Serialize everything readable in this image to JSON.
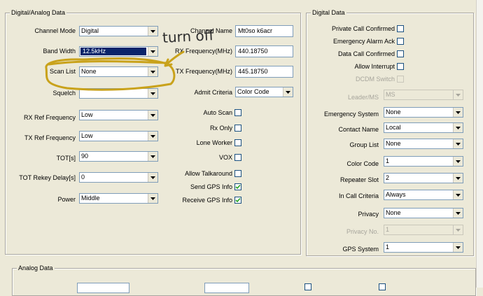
{
  "digital_analog": {
    "title": "Digital/Analog Data",
    "left_fields": {
      "channel_mode": {
        "label": "Channel Mode",
        "value": "Digital"
      },
      "band_width": {
        "label": "Band Width",
        "value": "12.5kHz"
      },
      "scan_list": {
        "label": "Scan List",
        "value": "None"
      },
      "squelch": {
        "label": "Squelch",
        "value": ""
      },
      "rx_ref": {
        "label": "RX Ref Frequency",
        "value": "Low"
      },
      "tx_ref": {
        "label": "TX Ref Frequency",
        "value": "Low"
      },
      "tot": {
        "label": "TOT[s]",
        "value": "90"
      },
      "tot_rekey": {
        "label": "TOT Rekey Delay[s]",
        "value": "0"
      },
      "power": {
        "label": "Power",
        "value": "Middle"
      }
    },
    "mid_fields": {
      "channel_name": {
        "label": "Channel Name",
        "value": "Mt0so k6acr"
      },
      "rx_freq": {
        "label": "RX Frequency(MHz)",
        "value": "440.18750"
      },
      "tx_freq": {
        "label": "TX Frequency(MHz)",
        "value": "445.18750"
      },
      "admit_criteria": {
        "label": "Admit Criteria",
        "value": "Color Code"
      }
    },
    "checkboxes": [
      {
        "label": "Auto Scan",
        "checked": false
      },
      {
        "label": "Rx Only",
        "checked": false
      },
      {
        "label": "Lone Worker",
        "checked": false
      },
      {
        "label": "VOX",
        "checked": false
      },
      {
        "label": "Allow Talkaround",
        "checked": false
      },
      {
        "label": "Send GPS Info",
        "checked": true
      },
      {
        "label": "Receive GPS Info",
        "checked": true
      }
    ]
  },
  "digital": {
    "title": "Digital Data",
    "checkboxes": {
      "private_call": {
        "label": "Private Call Confirmed",
        "checked": false
      },
      "emergency_ack": {
        "label": "Emergency Alarm Ack",
        "checked": false
      },
      "data_call": {
        "label": "Data Call Confirmed",
        "checked": false
      },
      "allow_interrupt": {
        "label": "Allow Interrupt",
        "checked": false
      },
      "dcdm_switch": {
        "label": "DCDM Switch",
        "checked": false
      }
    },
    "fields": {
      "leader_ms": {
        "label": "Leader/MS",
        "value": "MS"
      },
      "emergency_system": {
        "label": "Emergency System",
        "value": "None"
      },
      "contact_name": {
        "label": "Contact Name",
        "value": "Local"
      },
      "group_list": {
        "label": "Group List",
        "value": "None"
      },
      "color_code": {
        "label": "Color Code",
        "value": "1"
      },
      "repeater_slot": {
        "label": "Repeater Slot",
        "value": "2"
      },
      "in_call_criteria": {
        "label": "In Call Criteria",
        "value": "Always"
      },
      "privacy": {
        "label": "Privacy",
        "value": "None"
      },
      "privacy_no": {
        "label": "Privacy No.",
        "value": "1"
      },
      "gps_system": {
        "label": "GPS System",
        "value": "1"
      }
    }
  },
  "analog": {
    "title": "Analog Data"
  },
  "annotation": {
    "text": "turn off",
    "color": "#c9a21b"
  }
}
